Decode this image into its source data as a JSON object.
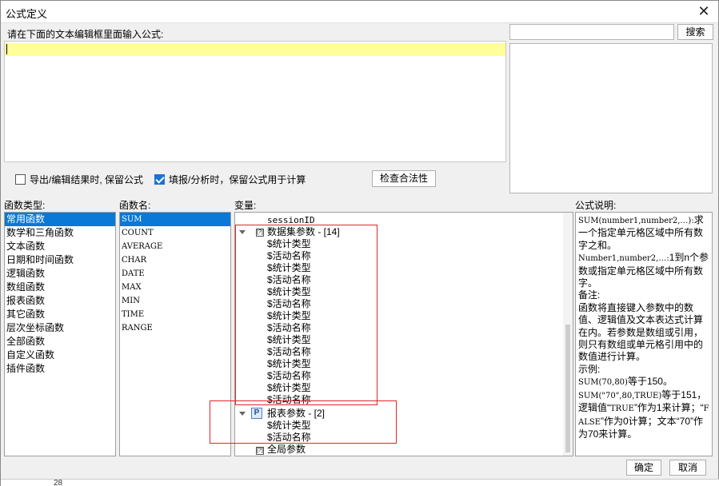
{
  "window": {
    "title": "公式定义",
    "close_icon": "close-icon"
  },
  "editor": {
    "prompt": "请在下面的文本编辑框里面输入公式:",
    "value": ""
  },
  "search": {
    "placeholder": "",
    "button": "搜索"
  },
  "options": {
    "export_keep_formula": {
      "label": "导出/编辑结果时, 保留公式",
      "checked": false
    },
    "fill_keep_formula": {
      "label": "填报/分析时，保留公式用于计算",
      "checked": true
    },
    "validate_button": "检查合法性"
  },
  "labels": {
    "func_type": "函数类型:",
    "func_name": "函数名:",
    "variables": "变量:",
    "formula_desc": "公式说明:"
  },
  "func_types": [
    "常用函数",
    "数学和三角函数",
    "文本函数",
    "日期和时间函数",
    "逻辑函数",
    "数组函数",
    "报表函数",
    "其它函数",
    "层次坐标函数",
    "全部函数",
    "自定义函数",
    "插件函数"
  ],
  "func_names": [
    "SUM",
    "COUNT",
    "AVERAGE",
    "CHAR",
    "DATE",
    "MAX",
    "MIN",
    "TIME",
    "RANGE"
  ],
  "variables": {
    "top_item": "sessionID",
    "dataset_group": "数据集参数 - [14]",
    "dataset_items": [
      "$统计类型",
      "$活动名称",
      "$统计类型",
      "$活动名称",
      "$统计类型",
      "$活动名称",
      "$统计类型",
      "$活动名称",
      "$统计类型",
      "$活动名称",
      "$统计类型",
      "$活动名称",
      "$统计类型",
      "$活动名称"
    ],
    "report_group": "报表参数 - [2]",
    "report_items": [
      "$统计类型",
      "$活动名称"
    ],
    "global_group": "全局参数"
  },
  "description": {
    "l1": "SUM(number1,number2,…):",
    "l1b": "求一个指定单元格区域中所有数字之和。",
    "l2": "Number1,number2,…:",
    "l2b": "1到n个参数或指定单元格区域中所有数字。",
    "l3": "备注:",
    "l4": "函数将直接键入参数中的数值、逻辑值及文本表达式计算在内。若参数是数组或引用，则只有数组或单元格引用中的数值进行计算。",
    "l5": "示例:",
    "l6a": "SUM(70,80)",
    "l6b": "等于150。",
    "l7a": "SUM(\"70\",80,TRUE)",
    "l7b": "等于151，逻辑值“",
    "l7c": "TRUE",
    "l7d": "”作为1来计算；“",
    "l7e": "FALSE",
    "l7f": "”作为0计算；文本“70”作为70来计算。"
  },
  "buttons": {
    "ok": "确定",
    "cancel": "取消"
  },
  "footer": {
    "row_number": "28"
  }
}
